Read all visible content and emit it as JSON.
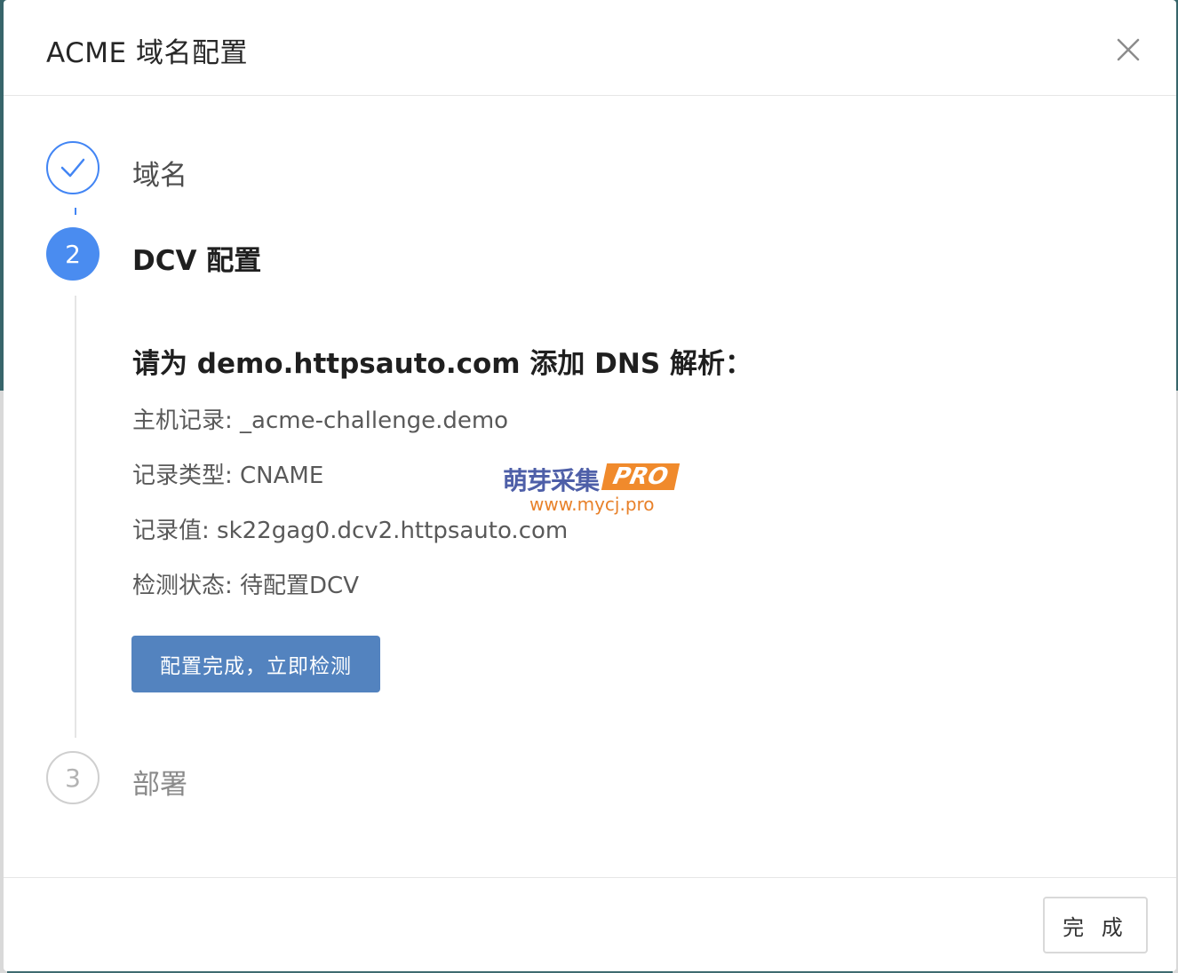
{
  "dialog": {
    "title": "ACME 域名配置",
    "close_icon": "close-icon"
  },
  "steps": [
    {
      "number": "1",
      "label": "域名",
      "status": "done",
      "icon": "check-icon"
    },
    {
      "number": "2",
      "label": "DCV 配置",
      "status": "active"
    },
    {
      "number": "3",
      "label": "部署",
      "status": "pending"
    }
  ],
  "dcv": {
    "heading": "请为 demo.httpsauto.com 添加 DNS 解析：",
    "host_record": "主机记录: _acme-challenge.demo",
    "record_type": "记录类型: CNAME",
    "record_value": "记录值: sk22gag0.dcv2.httpsauto.com",
    "check_status": "检测状态: 待配置DCV",
    "check_button": "配置完成，立即检测"
  },
  "watermark": {
    "name": "萌芽采集",
    "badge": "PRO",
    "url": "www.mycj.pro"
  },
  "footer": {
    "done_button": "完 成"
  },
  "colors": {
    "accent": "#4a8cf0",
    "button_primary": "#5383bf",
    "watermark_blue": "#4e5fa8",
    "watermark_orange": "#f08a2c"
  }
}
